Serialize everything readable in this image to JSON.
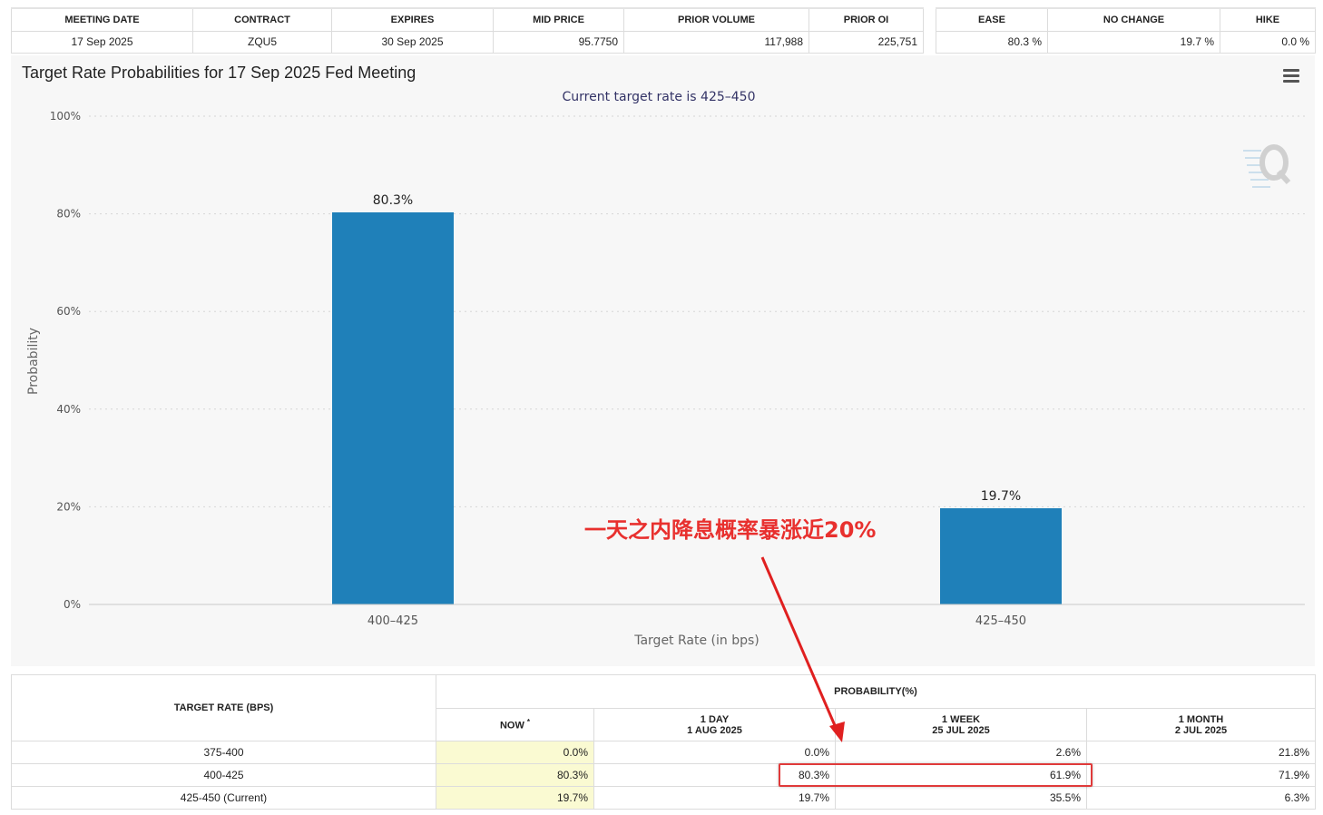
{
  "meeting_table": {
    "headers": [
      "MEETING DATE",
      "CONTRACT",
      "EXPIRES",
      "MID PRICE",
      "PRIOR VOLUME",
      "PRIOR OI"
    ],
    "row": [
      "17 Sep 2025",
      "ZQU5",
      "30 Sep 2025",
      "95.7750",
      "117,988",
      "225,751"
    ]
  },
  "prob_summary": {
    "headers": [
      "EASE",
      "NO CHANGE",
      "HIKE"
    ],
    "row": [
      "80.3 %",
      "19.7 %",
      "0.0 %"
    ]
  },
  "chart_panel": {
    "title": "Target Rate Probabilities for 17 Sep 2025 Fed Meeting",
    "menu_icon": "hamburger-menu-icon",
    "watermark_icon": "q-logo-icon"
  },
  "chart_data": {
    "type": "bar",
    "subtitle": "Current target rate is 425–450",
    "categories": [
      "400–425",
      "425–450"
    ],
    "values": [
      80.3,
      19.7
    ],
    "data_labels": [
      "80.3%",
      "19.7%"
    ],
    "xlabel": "Target Rate (in bps)",
    "ylabel": "Probability",
    "ylim": [
      0,
      100
    ],
    "yticks": [
      "0%",
      "20%",
      "40%",
      "60%",
      "80%",
      "100%"
    ],
    "grid": true,
    "bar_color": "#1f80b9"
  },
  "rate_table": {
    "col_target": "TARGET RATE (BPS)",
    "col_group": "PROBABILITY(%)",
    "now": {
      "label": "NOW",
      "mark": "*"
    },
    "day": {
      "line1": "1 DAY",
      "line2": "1 AUG 2025"
    },
    "week": {
      "line1": "1 WEEK",
      "line2": "25 JUL 2025"
    },
    "month": {
      "line1": "1 MONTH",
      "line2": "2 JUL 2025"
    },
    "rows": [
      {
        "rate": "375-400",
        "now": "0.0%",
        "day": "0.0%",
        "week": "2.6%",
        "month": "21.8%"
      },
      {
        "rate": "400-425",
        "now": "80.3%",
        "day": "80.3%",
        "week": "61.9%",
        "month": "71.9%"
      },
      {
        "rate": "425-450 (Current)",
        "now": "19.7%",
        "day": "19.7%",
        "week": "35.5%",
        "month": "6.3%"
      }
    ]
  },
  "annotation": {
    "text": "一天之内降息概率暴涨近20%",
    "color": "#e8302e"
  }
}
